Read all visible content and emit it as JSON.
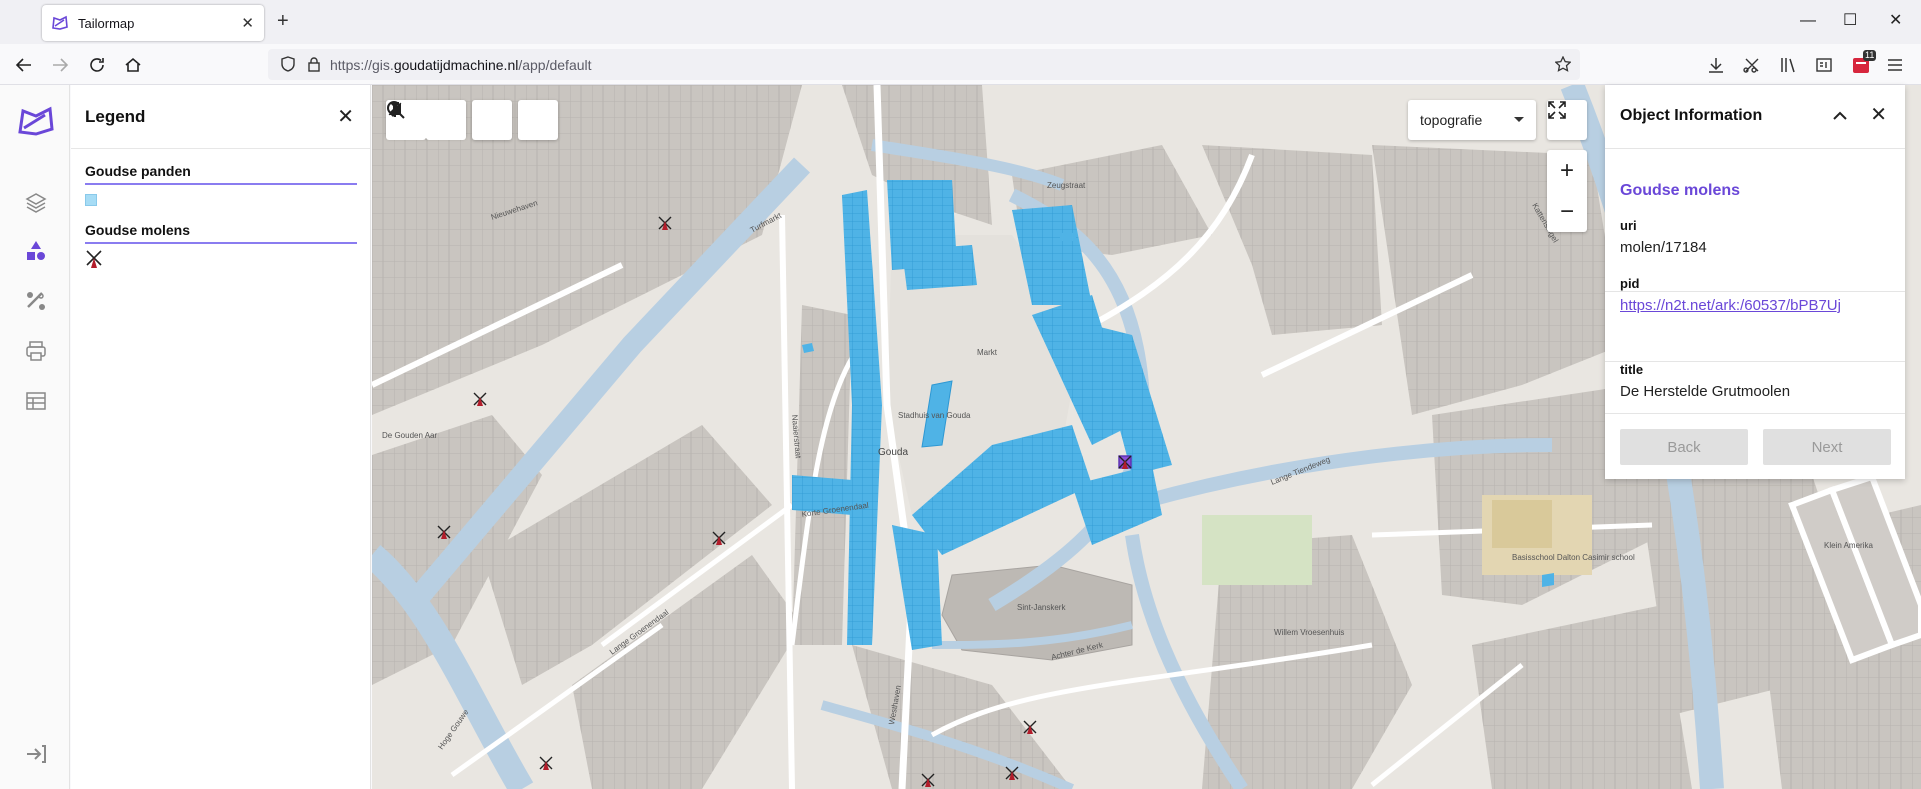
{
  "browser": {
    "tab_title": "Tailormap",
    "url_prefix": "https://gis.",
    "url_domain": "goudatijdmachine.nl",
    "url_path": "/app/default",
    "extension_badge": "11"
  },
  "sidebar": {
    "icons": [
      "layers-icon",
      "legend-icon",
      "tools-icon",
      "print-icon",
      "table-icon",
      "login-icon"
    ]
  },
  "legend": {
    "title": "Legend",
    "layers": [
      {
        "name": "Goudse panden",
        "symbol": "polygon-swatch"
      },
      {
        "name": "Goudse molens",
        "symbol": "windmill-marker"
      }
    ]
  },
  "map": {
    "background_layer": "topografie",
    "zoom_in": "+",
    "zoom_out": "−",
    "labels": {
      "gouda": "Gouda",
      "sint_janskerk": "Sint-Janskerk",
      "markt": "Markt",
      "stadhuis": "Stadhuis van Gouda",
      "turfmarkt": "Turfmarkt",
      "korte_groenendaal": "Korte Groenendaal",
      "lange_groenendaal": "Lange Groenendaal",
      "westhaven": "Westhaven",
      "zeugstraat": "Zeugstraat",
      "lange_tiendeweg": "Lange Tiendeweg",
      "klein_amerika": "Klein Amerika",
      "basisschool": "Basisschool Dalton Casimir school",
      "de_gouden_aar": "De Gouden Aar",
      "achter_de_kerk": "Achter de Kerk",
      "nieuwehaven": "Nieuwehaven",
      "willem_vroesenhuis": "Willem Vroesenhuis",
      "hoge_gouwe": "Hoge Gouwe",
      "naaierstraat": "Naaierstraat",
      "kattensingel": "Kattensingel"
    }
  },
  "object_info": {
    "title": "Object Information",
    "layer": "Goudse molens",
    "fields": [
      {
        "key": "uri",
        "value": "molen/17184",
        "link": false
      },
      {
        "key": "pid",
        "value": "https://n2t.net/ark:/60537/bPB7Uj",
        "link": true
      },
      {
        "key": "title",
        "value": "De Herstelde Grutmoolen",
        "link": false
      }
    ],
    "back_label": "Back",
    "next_label": "Next"
  },
  "colors": {
    "accent": "#6a47d8",
    "panden_fill": "#4fb3e6",
    "water": "#b8cfe2",
    "building": "#cfcbc6",
    "land": "#e9e6e1"
  }
}
